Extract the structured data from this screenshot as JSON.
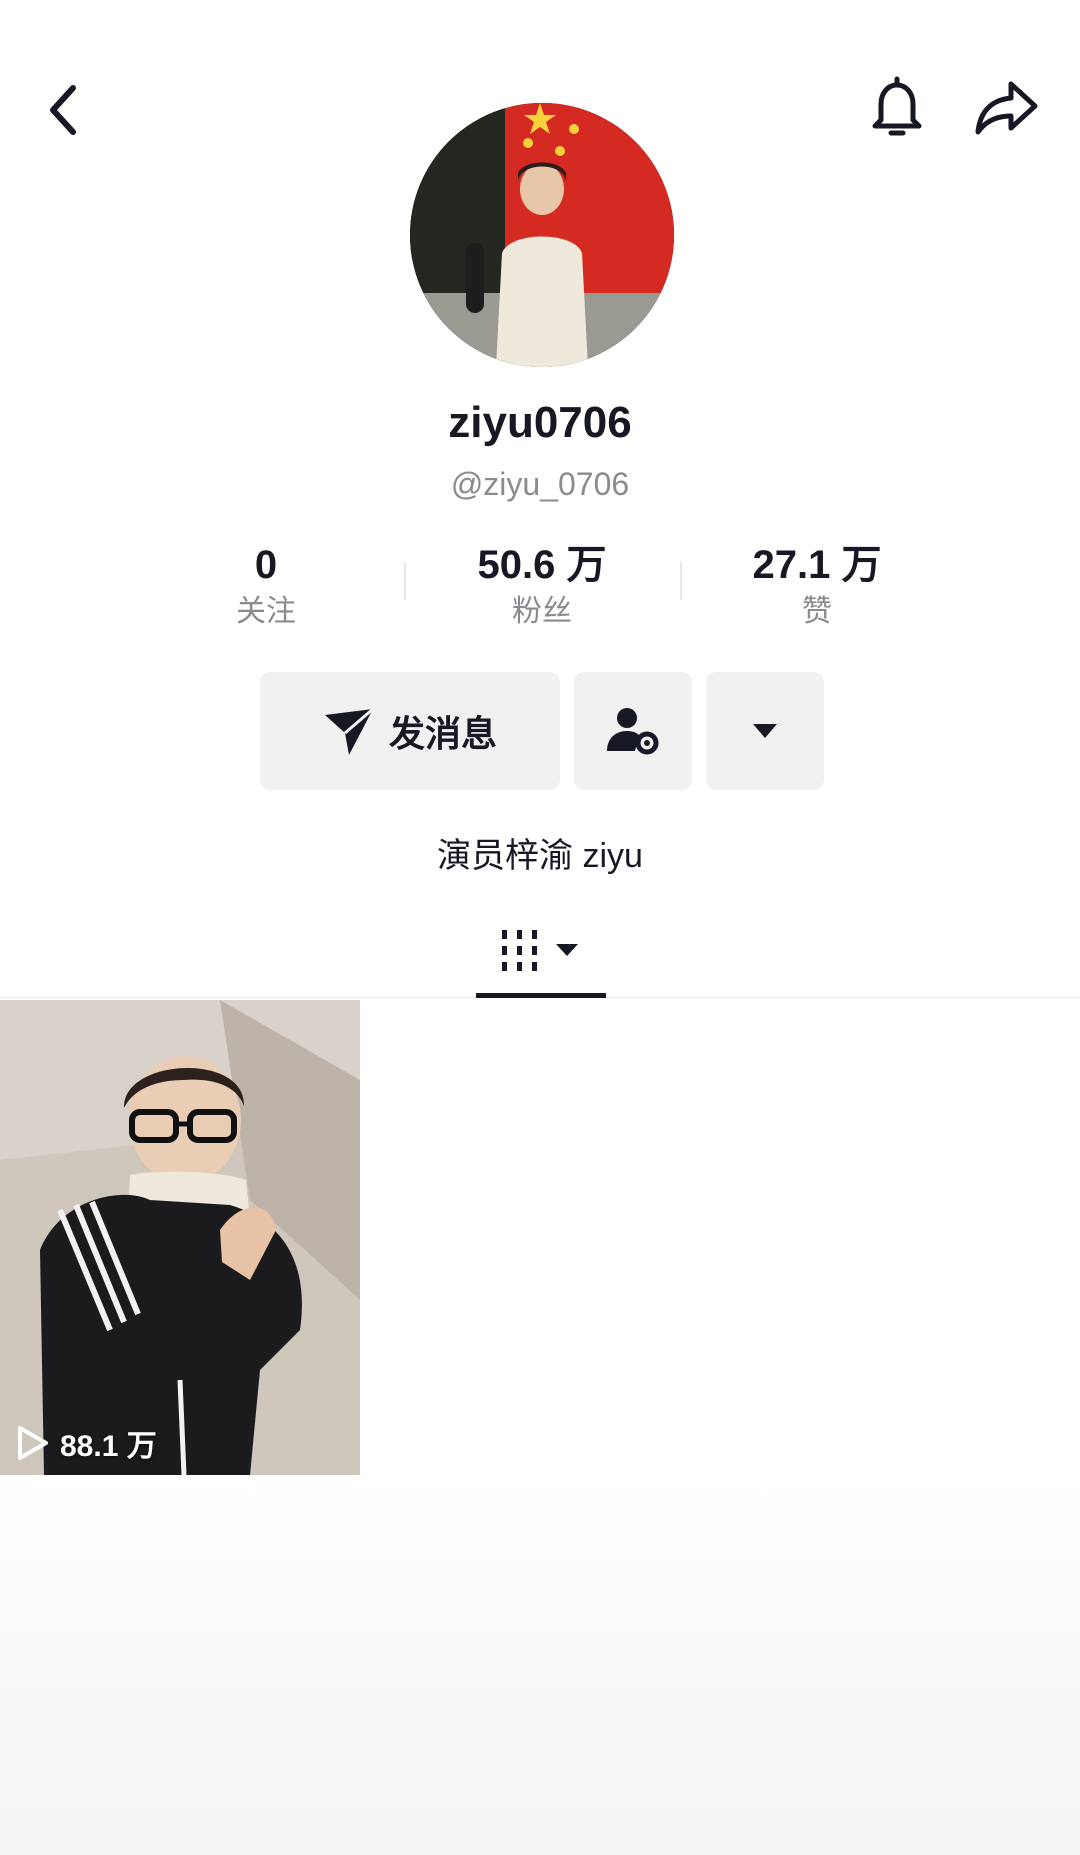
{
  "profile": {
    "display_name": "ziyu0706",
    "handle": "@ziyu_0706",
    "bio": "演员梓渝 ziyu"
  },
  "stats": {
    "following_count": "0",
    "following_label": "关注",
    "followers_count": "50.6 万",
    "followers_label": "粉丝",
    "likes_count": "27.1 万",
    "likes_label": "赞"
  },
  "actions": {
    "message_label": "发消息"
  },
  "videos": [
    {
      "plays": "88.1 万"
    }
  ],
  "icons": {
    "back": "chevron-left-icon",
    "notify": "bell-icon",
    "share": "share-arrow-icon",
    "message": "paper-plane-icon",
    "friend": "user-settings-icon",
    "more": "caret-down-icon",
    "works_tab": "grid-columns-icon",
    "play": "play-outline-icon"
  },
  "colors": {
    "text": "#161823",
    "muted": "#8a8b91",
    "button_bg": "#f1f1f2"
  }
}
